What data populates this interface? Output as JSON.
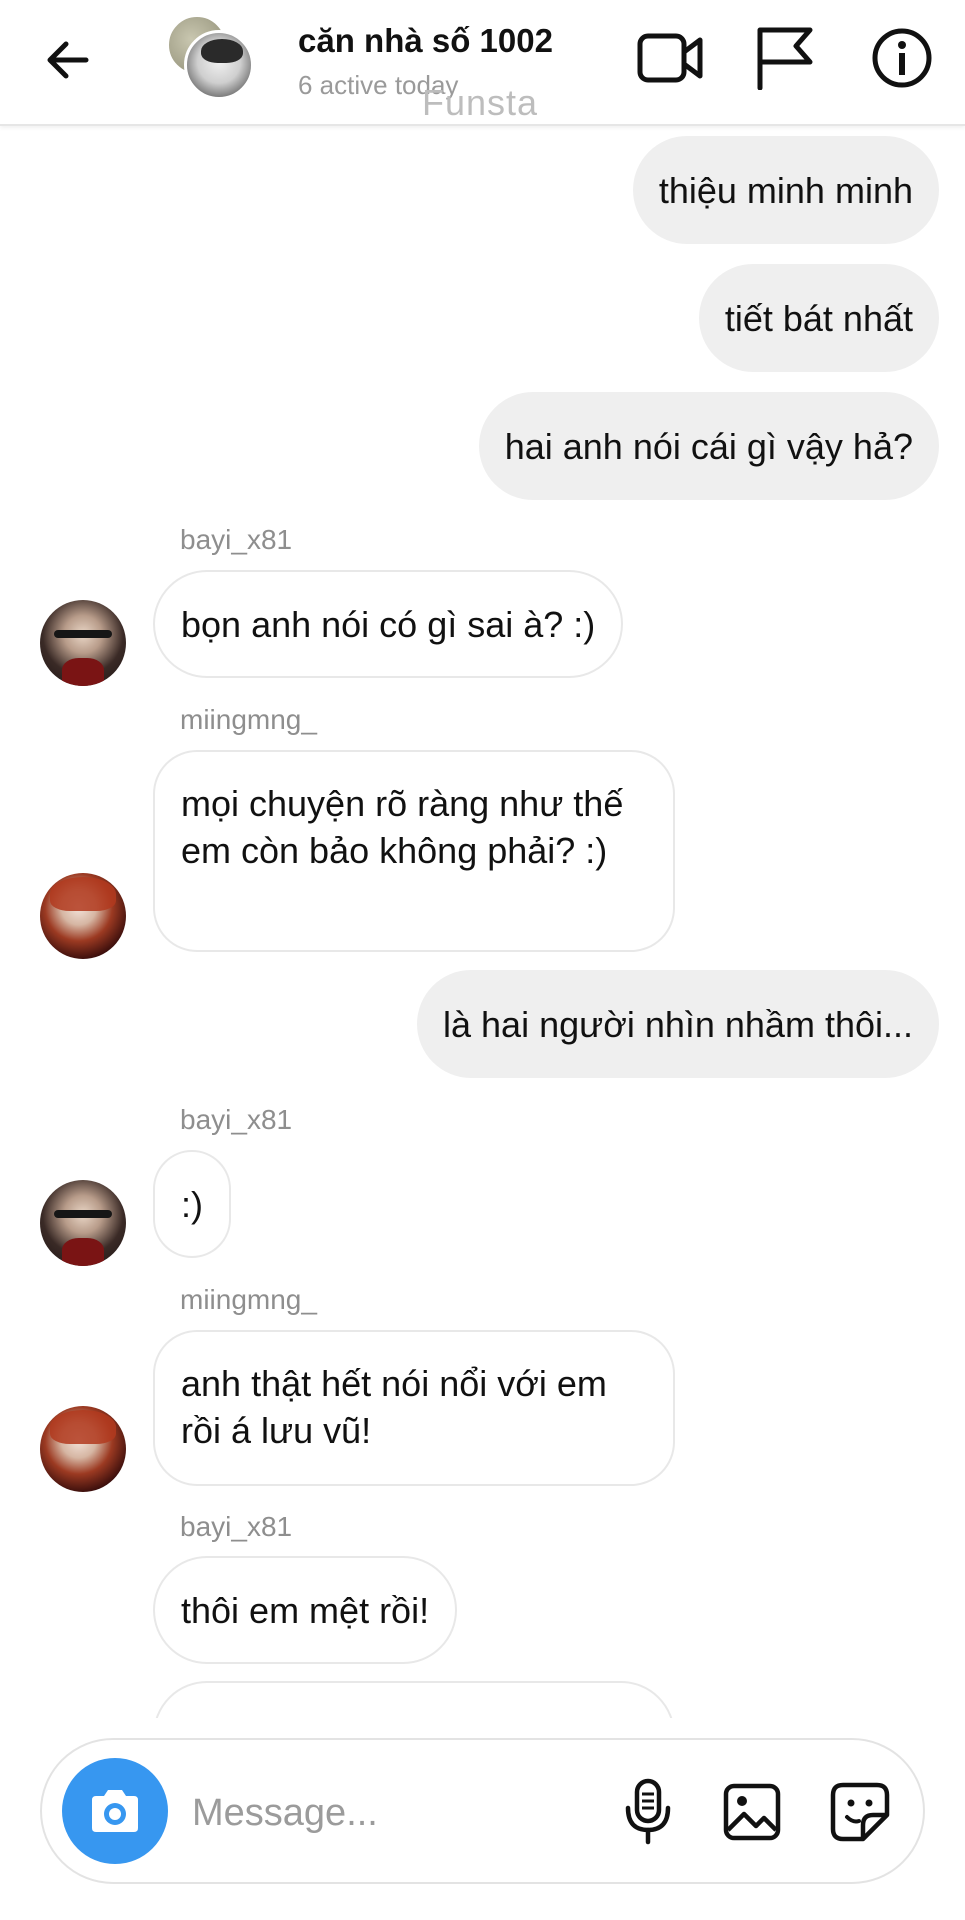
{
  "header": {
    "title": "căn nhà số 1002",
    "subtitle": "6 active today",
    "watermark": "Funsta"
  },
  "icons": {
    "back": "arrow-left-icon",
    "video": "video-camera-icon",
    "flag": "flag-icon",
    "info": "info-icon",
    "camera": "camera-icon",
    "mic": "microphone-icon",
    "gallery": "image-icon",
    "sticker": "sticker-icon"
  },
  "messages": [
    {
      "direction": "out",
      "text": "thiệu minh minh"
    },
    {
      "direction": "out",
      "text": "tiết bát nhất"
    },
    {
      "direction": "out",
      "text": "hai anh nói cái gì vậy hả?"
    },
    {
      "direction": "in",
      "sender": "bayi_x81",
      "text": "bọn anh nói có gì sai à? :)"
    },
    {
      "direction": "in",
      "sender": "miingmng_",
      "text": "mọi chuyện rõ ràng như thế em còn bảo không phải? :)"
    },
    {
      "direction": "out",
      "text": "là hai người nhìn nhầm thôi..."
    },
    {
      "direction": "in",
      "sender": "bayi_x81",
      "text": ":)"
    },
    {
      "direction": "in",
      "sender": "miingmng_",
      "text": "anh thật hết nói nổi với em rồi á lưu vũ!"
    },
    {
      "direction": "in",
      "sender": "bayi_x81",
      "text": "thôi em mệt rồi!"
    }
  ],
  "composer": {
    "placeholder": "Message..."
  },
  "colors": {
    "accent": "#3797f0",
    "outgoing_bubble": "#efefef",
    "muted_text": "#8e8e8e"
  }
}
